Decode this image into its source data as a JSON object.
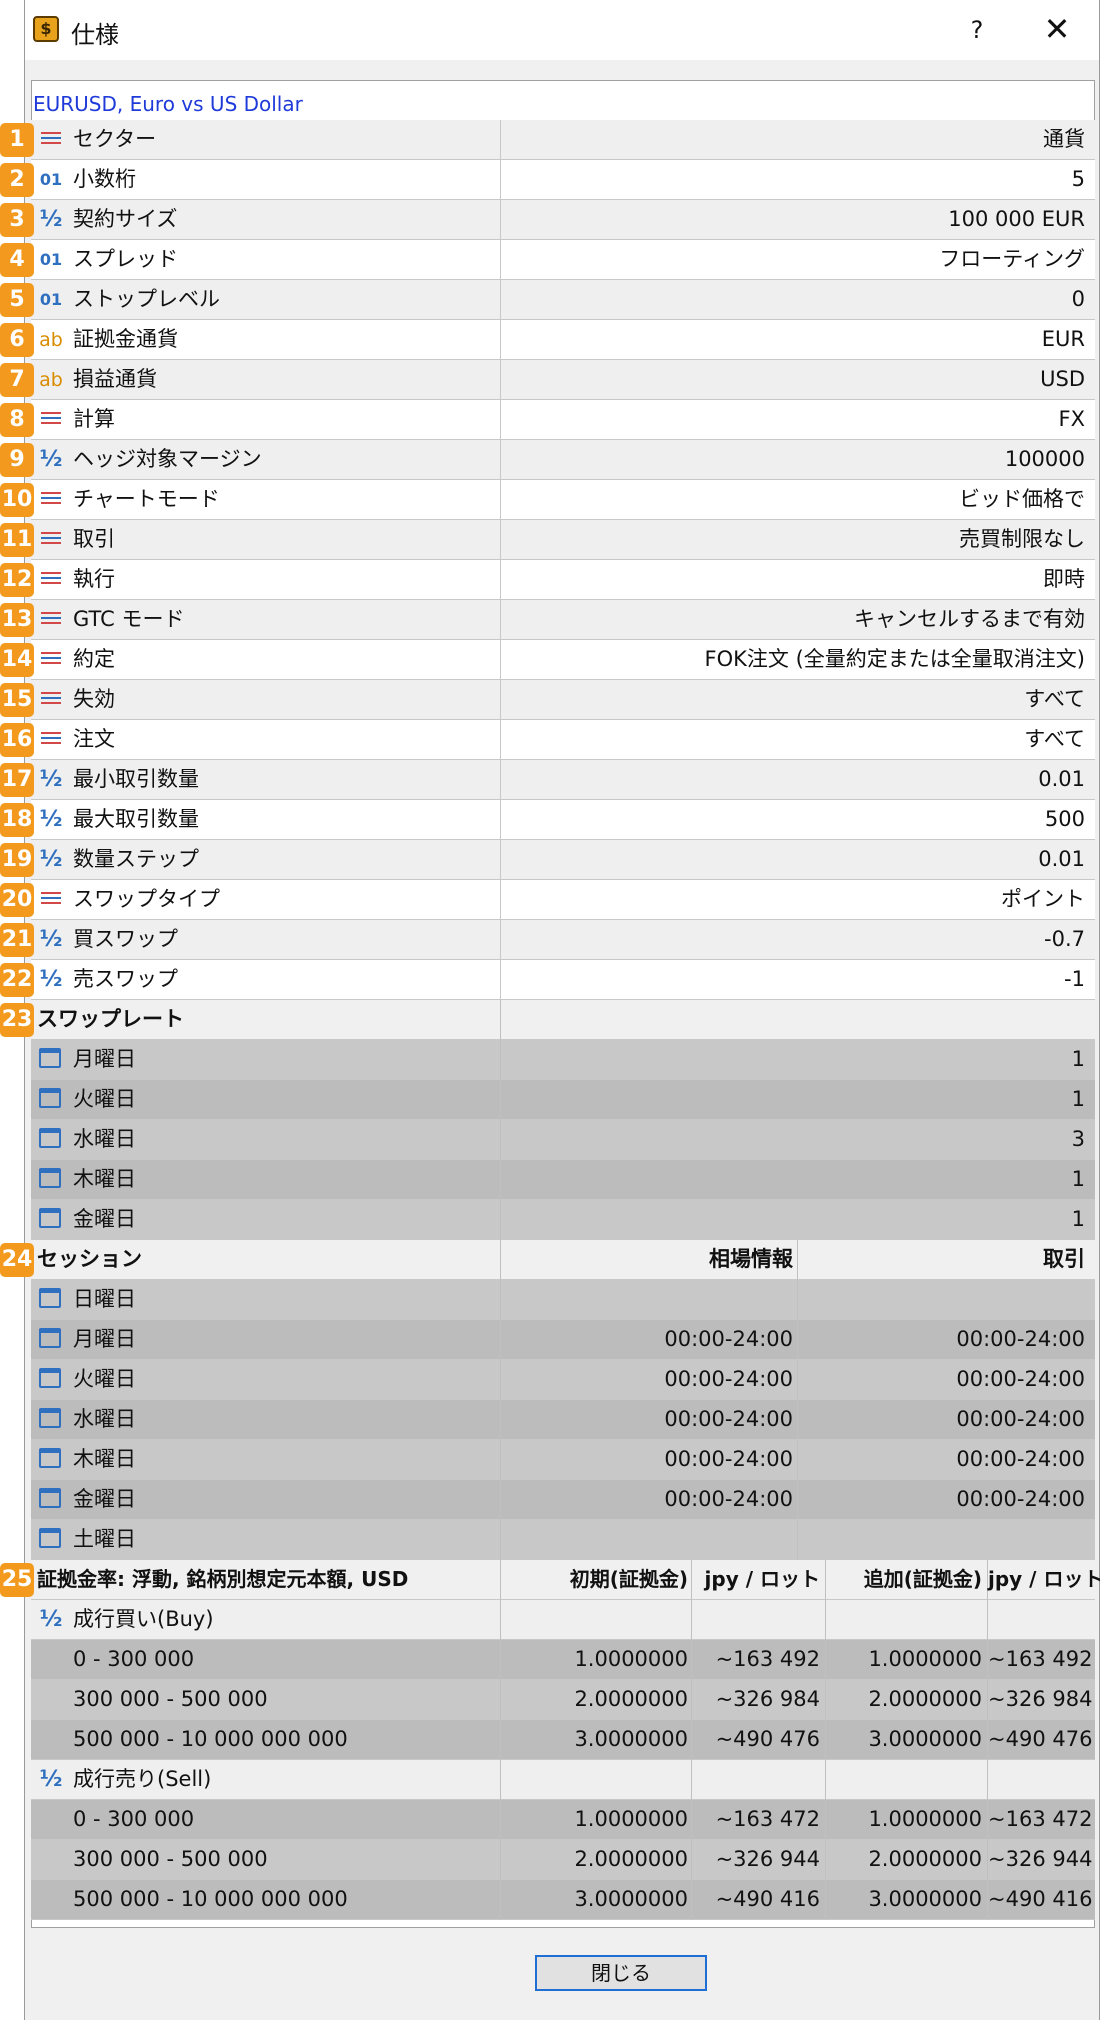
{
  "window": {
    "title": "仕様",
    "help": "?",
    "close": "✕",
    "app_icon": "$"
  },
  "symbol": "EURUSD, Euro vs US Dollar",
  "props": [
    {
      "icon": "list",
      "label": "セクター",
      "value": "通貨"
    },
    {
      "icon": "digit",
      "label": "小数桁",
      "value": "5"
    },
    {
      "icon": "half",
      "label": "契約サイズ",
      "value": "100 000 EUR"
    },
    {
      "icon": "digit",
      "label": "スプレッド",
      "value": "フローティング"
    },
    {
      "icon": "digit",
      "label": "ストップレベル",
      "value": "0"
    },
    {
      "icon": "ab",
      "label": "証拠金通貨",
      "value": "EUR"
    },
    {
      "icon": "ab",
      "label": "損益通貨",
      "value": "USD"
    },
    {
      "icon": "list",
      "label": "計算",
      "value": "FX"
    },
    {
      "icon": "half",
      "label": "ヘッジ対象マージン",
      "value": "100000"
    },
    {
      "icon": "list",
      "label": "チャートモード",
      "value": "ビッド価格で"
    },
    {
      "icon": "list",
      "label": "取引",
      "value": "売買制限なし"
    },
    {
      "icon": "list",
      "label": "執行",
      "value": "即時"
    },
    {
      "icon": "list",
      "label": "GTC モード",
      "value": "キャンセルするまで有効"
    },
    {
      "icon": "list",
      "label": "約定",
      "value": "FOK注文 (全量約定または全量取消注文)"
    },
    {
      "icon": "list",
      "label": "失効",
      "value": "すべて"
    },
    {
      "icon": "list",
      "label": "注文",
      "value": "すべて"
    },
    {
      "icon": "half",
      "label": "最小取引数量",
      "value": "0.01"
    },
    {
      "icon": "half",
      "label": "最大取引数量",
      "value": "500"
    },
    {
      "icon": "half",
      "label": "数量ステップ",
      "value": "0.01"
    },
    {
      "icon": "list",
      "label": "スワップタイプ",
      "value": "ポイント"
    },
    {
      "icon": "half",
      "label": "買スワップ",
      "value": "-0.7"
    },
    {
      "icon": "half",
      "label": "売スワップ",
      "value": "-1"
    }
  ],
  "swap": {
    "header": "スワップレート",
    "days": [
      {
        "day": "月曜日",
        "value": "1"
      },
      {
        "day": "火曜日",
        "value": "1"
      },
      {
        "day": "水曜日",
        "value": "3"
      },
      {
        "day": "木曜日",
        "value": "1"
      },
      {
        "day": "金曜日",
        "value": "1"
      }
    ]
  },
  "sessions": {
    "header": "セッション",
    "col_quotes": "相場情報",
    "col_trade": "取引",
    "days": [
      {
        "day": "日曜日",
        "quotes": "",
        "trade": ""
      },
      {
        "day": "月曜日",
        "quotes": "00:00-24:00",
        "trade": "00:00-24:00"
      },
      {
        "day": "火曜日",
        "quotes": "00:00-24:00",
        "trade": "00:00-24:00"
      },
      {
        "day": "水曜日",
        "quotes": "00:00-24:00",
        "trade": "00:00-24:00"
      },
      {
        "day": "木曜日",
        "quotes": "00:00-24:00",
        "trade": "00:00-24:00"
      },
      {
        "day": "金曜日",
        "quotes": "00:00-24:00",
        "trade": "00:00-24:00"
      },
      {
        "day": "土曜日",
        "quotes": "",
        "trade": ""
      }
    ]
  },
  "margin": {
    "header": "証拠金率: 浮動, 銘柄別想定元本額, USD",
    "cols": [
      "初期(証拠金)",
      "jpy / ロット",
      "追加(証拠金)",
      "jpy / ロット"
    ],
    "groups": [
      {
        "label": "成行買い(Buy)",
        "rows": [
          {
            "range": "0 - 300 000",
            "c1": "1.0000000",
            "c2": "~163 492",
            "c3": "1.0000000",
            "c4": "~163 492"
          },
          {
            "range": "300 000 - 500 000",
            "c1": "2.0000000",
            "c2": "~326 984",
            "c3": "2.0000000",
            "c4": "~326 984"
          },
          {
            "range": "500 000 - 10 000 000 000",
            "c1": "3.0000000",
            "c2": "~490 476",
            "c3": "3.0000000",
            "c4": "~490 476"
          }
        ]
      },
      {
        "label": "成行売り(Sell)",
        "rows": [
          {
            "range": "0 - 300 000",
            "c1": "1.0000000",
            "c2": "~163 472",
            "c3": "1.0000000",
            "c4": "~163 472"
          },
          {
            "range": "300 000 - 500 000",
            "c1": "2.0000000",
            "c2": "~326 944",
            "c3": "2.0000000",
            "c4": "~326 944"
          },
          {
            "range": "500 000 - 10 000 000 000",
            "c1": "3.0000000",
            "c2": "~490 416",
            "c3": "3.0000000",
            "c4": "~490 416"
          }
        ]
      }
    ]
  },
  "badges": [
    "1",
    "2",
    "3",
    "4",
    "5",
    "6",
    "7",
    "8",
    "9",
    "10",
    "11",
    "12",
    "13",
    "14",
    "15",
    "16",
    "17",
    "18",
    "19",
    "20",
    "21",
    "22",
    "23",
    "24",
    "25"
  ],
  "close_button": "閉じる",
  "colors": {
    "badge": "#f39a1e",
    "link": "#1e3ad9",
    "focus": "#1f6ed4"
  }
}
